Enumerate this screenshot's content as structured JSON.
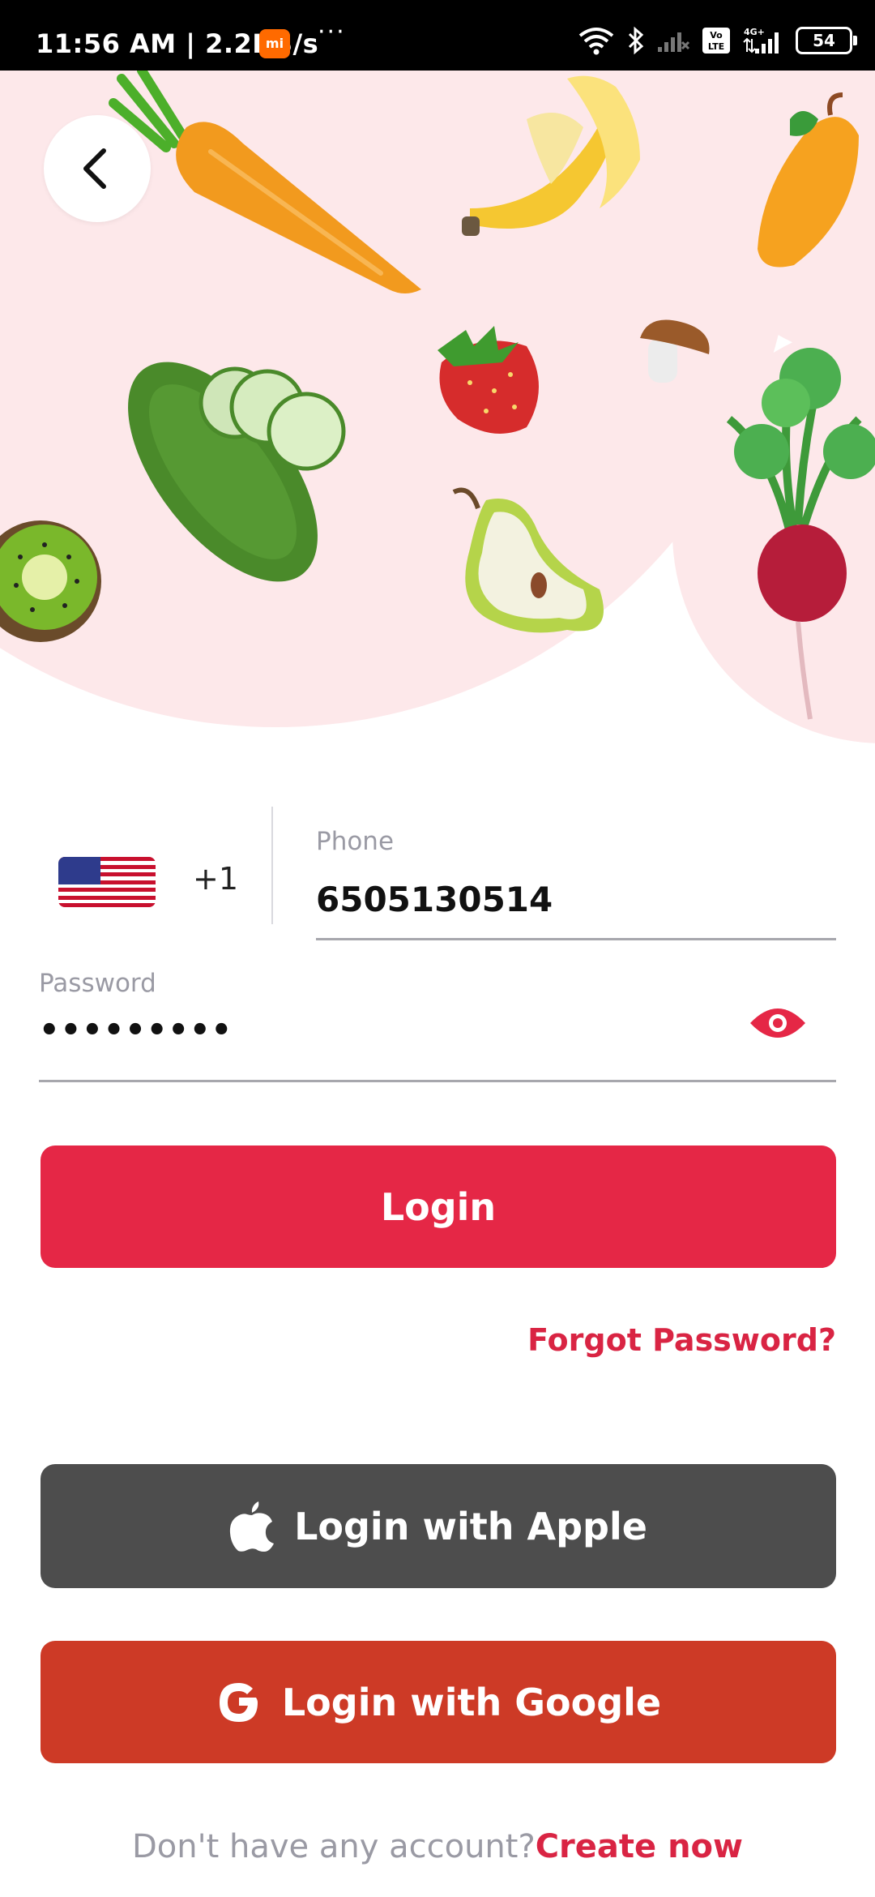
{
  "status_bar": {
    "time": "11:56 AM | 2.2KB/s",
    "mi_badge": "mi",
    "dots": "···",
    "volte_label": "Vo LTE",
    "network_label": "4G+",
    "battery": "54"
  },
  "hero": {
    "back_icon": "chevron-left-icon",
    "illustrations": [
      "carrot",
      "banana",
      "mango",
      "cucumber",
      "strawberry",
      "mushroom",
      "radish",
      "kiwi",
      "pear"
    ]
  },
  "form": {
    "country_code": "+1",
    "phone_label": "Phone",
    "phone_value": "6505130514",
    "password_label": "Password",
    "password_value": "•••••••••",
    "login_label": "Login",
    "forgot_label": "Forgot Password?"
  },
  "social": {
    "apple_label": "Login with Apple",
    "google_label": "Login with Google"
  },
  "footer": {
    "prompt": "Don't have any account?",
    "link": "Create now"
  },
  "colors": {
    "primary": "#e52746",
    "apple": "#4d4d4d",
    "google": "#cd3a26",
    "blob": "#fde8ea"
  }
}
